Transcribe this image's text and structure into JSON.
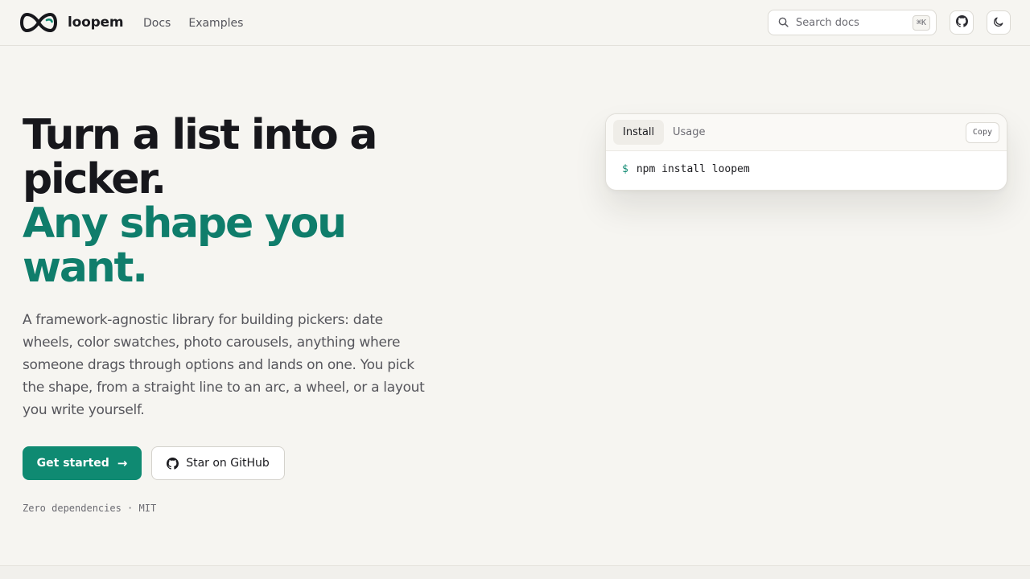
{
  "brand": {
    "name": "loopem",
    "logo_icon": "infinity-icon"
  },
  "nav": {
    "items": [
      {
        "label": "Docs"
      },
      {
        "label": "Examples"
      }
    ]
  },
  "search": {
    "placeholder": "Search docs",
    "shortcut": "⌘K",
    "icon": "search-icon"
  },
  "header_actions": {
    "github_icon": "github-icon",
    "theme_icon": "moon-icon"
  },
  "hero": {
    "headline_line1": "Turn a list into a picker.",
    "headline_line2": "Any shape you want.",
    "description": "A framework-agnostic library for building pickers: date wheels, color swatches, photo carousels, anything where someone drags through options and lands on one. You pick the shape, from a straight line to an arc, a wheel, or a layout you write yourself.",
    "primary_button": "Get started",
    "primary_button_icon": "→",
    "secondary_button": "Star on GitHub",
    "meta": "Zero dependencies · MIT"
  },
  "code_card": {
    "tabs": [
      {
        "label": "Install",
        "active": true
      },
      {
        "label": "Usage",
        "active": false
      }
    ],
    "copy_label": "Copy",
    "prompt": "$",
    "command": "npm install loopem"
  },
  "colors": {
    "accent": "#0f8a72",
    "headline_accent": "#0f7d6b",
    "background": "#f6f5f1"
  }
}
